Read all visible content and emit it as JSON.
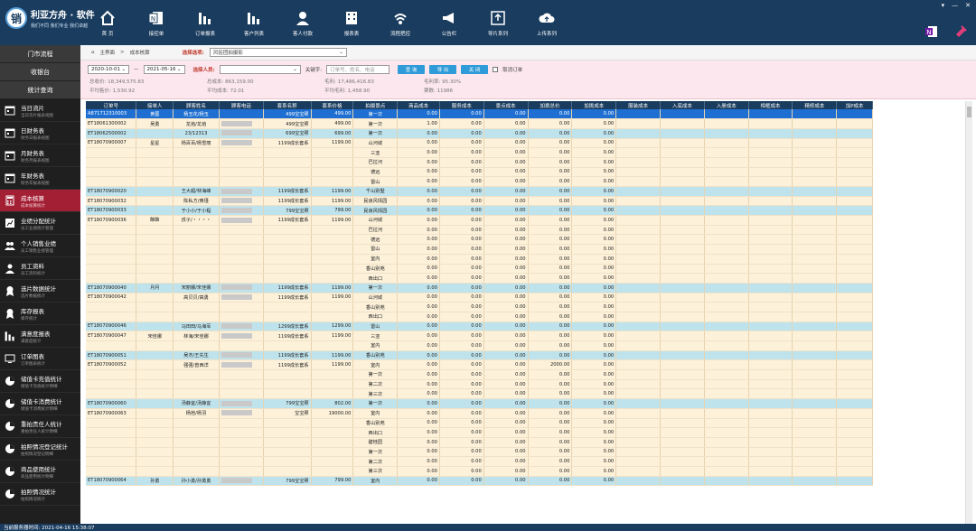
{
  "app": {
    "logo_char": "销",
    "name": "利亚方舟 · 软件",
    "slogan": "我们不同 我们专业 我们卓越"
  },
  "nav": [
    {
      "label": "首 页",
      "icon": "home-icon"
    },
    {
      "label": "接控单",
      "icon": "excel-icon"
    },
    {
      "label": "订单报表",
      "icon": "bar-chart-icon"
    },
    {
      "label": "客户列表",
      "icon": "bar-chart-icon"
    },
    {
      "label": "客人付款",
      "icon": "customer-icon"
    },
    {
      "label": "报表表",
      "icon": "building-icon"
    },
    {
      "label": "流程把控",
      "icon": "wifi-icon"
    },
    {
      "label": "公告栏",
      "icon": "megaphone-icon"
    },
    {
      "label": "导片系列",
      "icon": "export-icon"
    },
    {
      "label": "上传系列",
      "icon": "cloud-upload-icon"
    }
  ],
  "sidebar": {
    "top_items": [
      "门市流程",
      "收银台",
      "统计查询"
    ],
    "items": [
      {
        "title": "当日流片",
        "sub": "当日流片报表视图",
        "icon": "calendar-icon"
      },
      {
        "title": "日财务表",
        "sub": "财务日报表视图",
        "icon": "calendar-icon"
      },
      {
        "title": "月财务表",
        "sub": "财务月报表视图",
        "icon": "calendar-icon"
      },
      {
        "title": "年财务表",
        "sub": "财务年报表视图",
        "icon": "calendar-icon"
      },
      {
        "title": "成本核算",
        "sub": "成本核算统计",
        "icon": "calculator-icon"
      },
      {
        "title": "业绩分配统计",
        "sub": "员工业绩统计管理",
        "icon": "chart-icon"
      },
      {
        "title": "个人销售业绩",
        "sub": "员工销售业绩管理",
        "icon": "group-icon"
      },
      {
        "title": "员工资料",
        "sub": "员工资料统计",
        "icon": "person-icon"
      },
      {
        "title": "选片数据统计",
        "sub": "选片数据统计",
        "icon": "award-icon"
      },
      {
        "title": "库存报表",
        "sub": "库存统计",
        "icon": "award-icon"
      },
      {
        "title": "满意度报表",
        "sub": "满意度统计",
        "icon": "bar-chart-icon"
      },
      {
        "title": "订单图表",
        "sub": "订单图表统计",
        "icon": "monitor-icon"
      },
      {
        "title": "储值卡充值统计",
        "sub": "储值卡充值统计明细",
        "icon": "pie-icon"
      },
      {
        "title": "储值卡消费统计",
        "sub": "储值卡消费统计明细",
        "icon": "pie-icon"
      },
      {
        "title": "重拍责任人统计",
        "sub": "重拍责任人统计明细",
        "icon": "pie-icon"
      },
      {
        "title": "拍照情况登记统计",
        "sub": "拍照情况登记明细",
        "icon": "pie-icon"
      },
      {
        "title": "商品使用统计",
        "sub": "商品使用统计明细",
        "icon": "pie-icon"
      },
      {
        "title": "拍照情况统计",
        "sub": "拍照情况统计",
        "icon": "pie-icon"
      }
    ]
  },
  "breadcrumb": {
    "home": "主界面",
    "current": "成本核算",
    "select_label": "选择选项:",
    "select_value": "风俗团拍摄影"
  },
  "filter": {
    "date_from": "2020-10-01",
    "date_to": "2021-05-16",
    "person_label": "选择人员:",
    "keyword_label": "关键字:",
    "keyword_placeholder": "订单号、姓名、电话",
    "btn_query": "查 询",
    "btn_export": "导 出",
    "btn_close": "关 闭",
    "cancel_label": "取消订单"
  },
  "stats_row1": [
    {
      "label": "总收价:",
      "value": "18,349,575.83"
    },
    {
      "label": "总成本:",
      "value": "863,159.00"
    },
    {
      "label": "毛利:",
      "value": "17,486,416.83"
    },
    {
      "label": "毛利率:",
      "value": "95.30%"
    }
  ],
  "stats_row2": [
    {
      "label": "平均售价:",
      "value": "1,530.92"
    },
    {
      "label": "平均成本:",
      "value": "72.01"
    },
    {
      "label": "平均毛利:",
      "value": "1,458.90"
    },
    {
      "label": "票数:",
      "value": "11986"
    }
  ],
  "table": {
    "columns": [
      "订单号",
      "接单人",
      "顾客姓名",
      "顾客电话",
      "套系名称",
      "套系价格",
      "拍摄景点",
      "商品成本",
      "服务成本",
      "景点成本",
      "加挑总价",
      "加挑成本",
      "服装成本",
      "入底成本",
      "入册成本",
      "相框成本",
      "精修成本",
      "加P成本"
    ],
    "rows": [
      {
        "s": "sel",
        "c": [
          "A871712310003",
          "黄蓉",
          "杨玉花/杨玉",
          "",
          "499宝宝照",
          "499.00",
          "第一次",
          "0.00",
          "0.00",
          "0.00",
          "0.00",
          "0.00"
        ]
      },
      {
        "s": "cream",
        "c": [
          "ET18061300002",
          "吴勇",
          "龙焰/龙焰",
          "b",
          "499宝宝照",
          "499.00",
          "第一次",
          "1.00",
          "0.00",
          "0.00",
          "0.00",
          "0.00"
        ]
      },
      {
        "s": "blue",
        "c": [
          "ET18062500002",
          "",
          "23/12313",
          "b",
          "699宝宝照",
          "699.00",
          "第一次",
          "0.00",
          "0.00",
          "0.00",
          "0.00",
          "0.00"
        ]
      },
      {
        "s": "cream",
        "c": [
          "ET18070900007",
          "星星",
          "杨百百/杨雪丽",
          "b",
          "1199成长套系",
          "1199.00",
          "山河城",
          "0.00",
          "0.00",
          "0.00",
          "0.00",
          "0.00"
        ]
      },
      {
        "s": "cream",
        "c": [
          "",
          "",
          "",
          "",
          "",
          "",
          "三亚",
          "0.00",
          "0.00",
          "0.00",
          "0.00",
          "0.00"
        ]
      },
      {
        "s": "cream",
        "c": [
          "",
          "",
          "",
          "",
          "",
          "",
          "巴拉河",
          "0.00",
          "0.00",
          "0.00",
          "0.00",
          "0.00"
        ]
      },
      {
        "s": "cream",
        "c": [
          "",
          "",
          "",
          "",
          "",
          "",
          "德远",
          "0.00",
          "0.00",
          "0.00",
          "0.00",
          "0.00"
        ]
      },
      {
        "s": "cream",
        "c": [
          "",
          "",
          "",
          "",
          "",
          "",
          "雷山",
          "0.00",
          "0.00",
          "0.00",
          "0.00",
          "0.00"
        ]
      },
      {
        "s": "blue",
        "c": [
          "ET18070900020",
          "",
          "王大超/林海峰",
          "b",
          "1199成长套系",
          "1199.00",
          "千山别墅",
          "0.00",
          "0.00",
          "0.00",
          "0.00",
          "0.00"
        ]
      },
      {
        "s": "cream",
        "c": [
          "ET18070900032",
          "",
          "陈私方/黄瑾",
          "b",
          "1199成长套系",
          "1199.00",
          "民良风情园",
          "0.00",
          "0.00",
          "0.00",
          "0.00",
          "0.00"
        ]
      },
      {
        "s": "blue",
        "c": [
          "ET18070900033",
          "",
          "于小小/于小程",
          "b",
          "799宝宝照",
          "799.00",
          "民良风情园",
          "0.00",
          "0.00",
          "0.00",
          "0.00",
          "0.00"
        ]
      },
      {
        "s": "cream",
        "c": [
          "ET18070900036",
          "睢睢",
          "孩子/・・・・",
          "b",
          "1199成长套系",
          "1199.00",
          "山河城",
          "0.00",
          "0.00",
          "0.00",
          "0.00",
          "0.00"
        ]
      },
      {
        "s": "cream",
        "c": [
          "",
          "",
          "",
          "",
          "",
          "",
          "巴拉河",
          "0.00",
          "0.00",
          "0.00",
          "0.00",
          "0.00"
        ]
      },
      {
        "s": "cream",
        "c": [
          "",
          "",
          "",
          "",
          "",
          "",
          "德远",
          "0.00",
          "0.00",
          "0.00",
          "0.00",
          "0.00"
        ]
      },
      {
        "s": "cream",
        "c": [
          "",
          "",
          "",
          "",
          "",
          "",
          "雷山",
          "0.00",
          "0.00",
          "0.00",
          "0.00",
          "0.00"
        ]
      },
      {
        "s": "cream",
        "c": [
          "",
          "",
          "",
          "",
          "",
          "",
          "室内",
          "0.00",
          "0.00",
          "0.00",
          "0.00",
          "0.00"
        ]
      },
      {
        "s": "cream",
        "c": [
          "",
          "",
          "",
          "",
          "",
          "",
          "香山别苑",
          "0.00",
          "0.00",
          "0.00",
          "0.00",
          "0.00"
        ]
      },
      {
        "s": "cream",
        "c": [
          "",
          "",
          "",
          "",
          "",
          "",
          "西出口",
          "0.00",
          "0.00",
          "0.00",
          "0.00",
          "0.00"
        ]
      },
      {
        "s": "blue",
        "c": [
          "ET18070900040",
          "月月",
          "宋丽娜/宋佳娜",
          "b",
          "1199成长套系",
          "1199.00",
          "第一次",
          "0.00",
          "0.00",
          "0.00",
          "0.00",
          "0.00"
        ]
      },
      {
        "s": "cream",
        "c": [
          "ET18070900042",
          "",
          "高贝贝/高勇",
          "b",
          "1199成长套系",
          "1199.00",
          "山河城",
          "0.00",
          "0.00",
          "0.00",
          "0.00",
          "0.00"
        ]
      },
      {
        "s": "cream",
        "c": [
          "",
          "",
          "",
          "",
          "",
          "",
          "香山别苑",
          "0.00",
          "0.00",
          "0.00",
          "0.00",
          "0.00"
        ]
      },
      {
        "s": "cream",
        "c": [
          "",
          "",
          "",
          "",
          "",
          "",
          "西出口",
          "0.00",
          "0.00",
          "0.00",
          "0.00",
          "0.00"
        ]
      },
      {
        "s": "blue",
        "c": [
          "ET18070900046",
          "",
          "马田田/马海军",
          "b",
          "1299成长套系",
          "1299.00",
          "雷山",
          "0.00",
          "0.00",
          "0.00",
          "0.00",
          "0.00"
        ]
      },
      {
        "s": "cream",
        "c": [
          "ET18070900047",
          "宋佳娜",
          "林海/宋佳娜",
          "b",
          "1199成长套系",
          "1199.00",
          "三亚",
          "0.00",
          "0.00",
          "0.00",
          "0.00",
          "0.00"
        ]
      },
      {
        "s": "cream",
        "c": [
          "",
          "",
          "",
          "",
          "",
          "",
          "室内",
          "0.00",
          "0.00",
          "0.00",
          "0.00",
          "0.00"
        ]
      },
      {
        "s": "blue",
        "c": [
          "ET18070900051",
          "",
          "吴杰/王先生",
          "b",
          "1199成长套系",
          "1199.00",
          "香山别苑",
          "0.00",
          "0.00",
          "0.00",
          "0.00",
          "0.00"
        ]
      },
      {
        "s": "cream",
        "c": [
          "ET18070900052",
          "",
          "强强/曾西洋",
          "b",
          "1199成长套系",
          "1199.00",
          "室内",
          "0.00",
          "0.00",
          "0.00",
          "2000.00",
          "0.00"
        ]
      },
      {
        "s": "cream",
        "c": [
          "",
          "",
          "",
          "",
          "",
          "",
          "第一次",
          "0.00",
          "0.00",
          "0.00",
          "0.00",
          "0.00"
        ]
      },
      {
        "s": "cream",
        "c": [
          "",
          "",
          "",
          "",
          "",
          "",
          "第二次",
          "0.00",
          "0.00",
          "0.00",
          "0.00",
          "0.00"
        ]
      },
      {
        "s": "cream",
        "c": [
          "",
          "",
          "",
          "",
          "",
          "",
          "第三次",
          "0.00",
          "0.00",
          "0.00",
          "0.00",
          "0.00"
        ]
      },
      {
        "s": "blue",
        "c": [
          "ET18070900060",
          "",
          "汤静宜/汤静宜",
          "b",
          "799宝宝照",
          "802.00",
          "第一次",
          "0.00",
          "0.00",
          "0.00",
          "0.00",
          "0.00"
        ]
      },
      {
        "s": "cream",
        "c": [
          "ET18070900063",
          "",
          "杨芭/杨羽",
          "b",
          "宝宝照",
          "19000.00",
          "室内",
          "0.00",
          "0.00",
          "0.00",
          "0.00",
          "0.00"
        ]
      },
      {
        "s": "cream",
        "c": [
          "",
          "",
          "",
          "",
          "",
          "",
          "香山别苑",
          "0.00",
          "0.00",
          "0.00",
          "0.00",
          "0.00"
        ]
      },
      {
        "s": "cream",
        "c": [
          "",
          "",
          "",
          "",
          "",
          "",
          "西出口",
          "0.00",
          "0.00",
          "0.00",
          "0.00",
          "0.00"
        ]
      },
      {
        "s": "cream",
        "c": [
          "",
          "",
          "",
          "",
          "",
          "",
          "碧桂园",
          "0.00",
          "0.00",
          "0.00",
          "0.00",
          "0.00"
        ]
      },
      {
        "s": "cream",
        "c": [
          "",
          "",
          "",
          "",
          "",
          "",
          "第一次",
          "0.00",
          "0.00",
          "0.00",
          "0.00",
          "0.00"
        ]
      },
      {
        "s": "cream",
        "c": [
          "",
          "",
          "",
          "",
          "",
          "",
          "第二次",
          "0.00",
          "0.00",
          "0.00",
          "0.00",
          "0.00"
        ]
      },
      {
        "s": "cream",
        "c": [
          "",
          "",
          "",
          "",
          "",
          "",
          "第三次",
          "0.00",
          "0.00",
          "0.00",
          "0.00",
          "0.00"
        ]
      },
      {
        "s": "blue",
        "c": [
          "ET18070900064",
          "孙勇",
          "孙小勇/孙勇勇",
          "b",
          "799宝宝照",
          "799.00",
          "室内",
          "0.00",
          "0.00",
          "0.00",
          "0.00",
          "0.00"
        ]
      }
    ]
  },
  "status_bar": "当前服务器时间: 2021-04-16 15:38:07",
  "colors": {
    "topbar": "#1a3c5e",
    "sidebar": "#1f1f1f",
    "active": "#a31f34",
    "row_blue": "#bfe3ec",
    "row_cream": "#fdf1d9",
    "row_selected": "#1e6fd1",
    "button": "#2f9bd8"
  }
}
